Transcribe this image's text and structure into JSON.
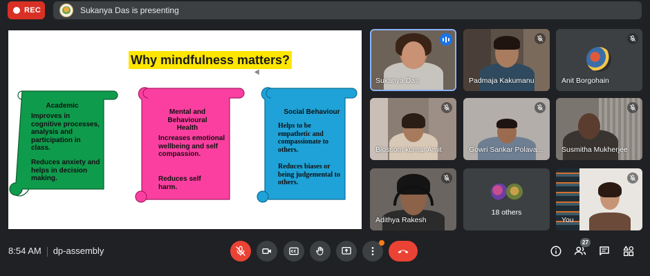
{
  "topbar": {
    "rec_label": "REC",
    "presenting_text": "Sukanya Das is presenting"
  },
  "slide": {
    "title": "Why mindfulness matters?",
    "scrolls": [
      {
        "heading": "Academic",
        "color": "#0f9b4c",
        "paragraphs": [
          "Improves in cognitive processes, analysis and participation in class.",
          "Reduces anxiety and helps in decision making."
        ]
      },
      {
        "heading": "Mental and Behavioural Health",
        "color": "#fb3fa0",
        "paragraphs": [
          "Increases emotional wellbeing and self compassion.",
          "Reduces self harm."
        ]
      },
      {
        "heading": "Social Behaviour",
        "color": "#1ea2d8",
        "paragraphs": [
          "Helps to be empathetic and compassionate to others.",
          "Reduces biases or being judgemental to others."
        ]
      }
    ]
  },
  "participants": [
    {
      "name": "Sukanya Das",
      "state": "speaking"
    },
    {
      "name": "Padmaja Kakumanu",
      "state": "muted"
    },
    {
      "name": "Anit Borgohain",
      "state": "muted"
    },
    {
      "name": "Blossom kumar Amit",
      "state": "muted"
    },
    {
      "name": "Gowri Sankar Polava...",
      "state": "muted"
    },
    {
      "name": "Susmitha Mukherjee",
      "state": "muted"
    },
    {
      "name": "Adithya Rakesh",
      "state": "muted"
    },
    {
      "name": "18 others",
      "state": "group"
    },
    {
      "name": "You",
      "state": "muted"
    }
  ],
  "bottombar": {
    "time": "8:54 AM",
    "meeting_code": "dp-assembly",
    "participant_count": "27"
  },
  "colors": {
    "background": "#202124",
    "tile": "#3c4043",
    "accent_red": "#ea4335",
    "speaking_blue": "#1a73e8"
  }
}
